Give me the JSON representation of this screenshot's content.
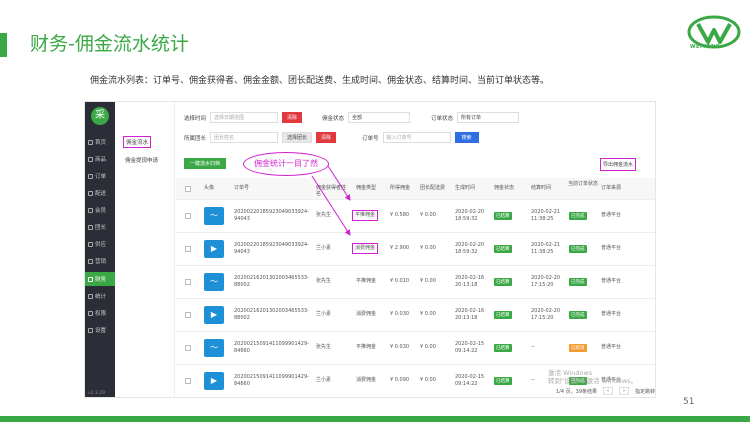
{
  "slide": {
    "title": "财务-佣金流水统计",
    "description": "佣金流水列表：订单号、佣金获得者、佣金金额、团长配送费、生成时间、佣金状态、结算时间、当前订单状态等。",
    "page_number": "51",
    "logo_text": "WEIYONG",
    "callout": "佣金统计一目了然"
  },
  "sidebar": {
    "logo_glyph": "采",
    "items": [
      {
        "label": "首页",
        "icon": "home-icon"
      },
      {
        "label": "商品",
        "icon": "goods-icon"
      },
      {
        "label": "订单",
        "icon": "order-icon"
      },
      {
        "label": "配送",
        "icon": "delivery-icon"
      },
      {
        "label": "会员",
        "icon": "member-icon"
      },
      {
        "label": "团长",
        "icon": "leader-icon"
      },
      {
        "label": "供应",
        "icon": "supply-icon"
      },
      {
        "label": "营销",
        "icon": "marketing-icon"
      },
      {
        "label": "财务",
        "icon": "finance-icon",
        "active": true
      },
      {
        "label": "统计",
        "icon": "stats-icon"
      },
      {
        "label": "权限",
        "icon": "permission-icon"
      },
      {
        "label": "设置",
        "icon": "settings-icon"
      }
    ],
    "version": "v2.3.29"
  },
  "subnav": {
    "items": [
      "佣金流水",
      "佣金提现申请"
    ]
  },
  "filters": {
    "time_label": "选择时间",
    "time_placeholder": "选择日期范围",
    "clear_label": "清除",
    "status_label": "佣金状态",
    "status_value": "全部",
    "order_status_label": "订单状态",
    "order_status_value": "所有订单",
    "leader_label": "所属团长",
    "leader_placeholder": "团长姓名",
    "select_leader_label": "选择团长",
    "clear2_label": "清除",
    "order_no_label": "订单号",
    "order_no_placeholder": "输入订单号",
    "search_label": "搜索"
  },
  "toolbar": {
    "settle_label": "一键流水归档",
    "export_label": "导出佣金流水"
  },
  "table": {
    "headers": [
      "头像",
      "订单号",
      "佣金获得者姓名",
      "佣金类型",
      "所得佣金",
      "团长配送费",
      "生成时间",
      "佣金状态",
      "结算时间",
      "当前订单状态",
      "订单来源"
    ],
    "rows": [
      {
        "order": "2020022018592304903392494043",
        "order_a": "20200220185923049033924-",
        "order_b": "94043",
        "name": "张先生",
        "type": "平推佣金",
        "amount": "¥ 0.580",
        "fee": "¥ 0.00",
        "created_a": "2020-02-20",
        "created_b": "18:59:32",
        "status": "已结算",
        "settled_a": "2020-02-21",
        "settled_b": "11:38:25",
        "order_status": "已完成",
        "source": "普通平台",
        "hl_type": true
      },
      {
        "order_a": "20200220185923049033924-",
        "order_b": "94043",
        "name": "兰小素",
        "type": "消费佣金",
        "amount": "¥ 2.900",
        "fee": "¥ 0.00",
        "created_a": "2020-02-20",
        "created_b": "18:59:32",
        "status": "已结算",
        "settled_a": "2020-02-21",
        "settled_b": "11:38:25",
        "order_status": "已完成",
        "source": "普通平台",
        "hl_type": true
      },
      {
        "order_a": "20200216201302003465533-",
        "order_b": "88002",
        "name": "张先生",
        "type": "平推佣金",
        "amount": "¥ 0.010",
        "fee": "¥ 0.00",
        "created_a": "2020-02-16",
        "created_b": "20:13:18",
        "status": "已结算",
        "settled_a": "2020-02-20",
        "settled_b": "17:15:20",
        "order_status": "已完成",
        "source": "普通平台"
      },
      {
        "order_a": "20200216201302003465533-",
        "order_b": "88002",
        "name": "兰小素",
        "type": "消费佣金",
        "amount": "¥ 0.030",
        "fee": "¥ 0.00",
        "created_a": "2020-02-16",
        "created_b": "20:13:18",
        "status": "已结算",
        "settled_a": "2020-02-20",
        "settled_b": "17:15:20",
        "order_status": "已完成",
        "source": "普通平台"
      },
      {
        "order_a": "20200215091411099901429-",
        "order_b": "84660",
        "name": "张先生",
        "type": "平推佣金",
        "amount": "¥ 0.030",
        "fee": "¥ 0.00",
        "created_a": "2020-02-15",
        "created_b": "09:14:22",
        "status": "已结算",
        "settled_a": "--",
        "settled_b": "",
        "order_status": "已取消",
        "source": "普通平台"
      },
      {
        "order_a": "20200215091411099901429-",
        "order_b": "84660",
        "name": "兰小素",
        "type": "消费佣金",
        "amount": "¥ 0.090",
        "fee": "¥ 0.00",
        "created_a": "2020-02-15",
        "created_b": "09:14:22",
        "status": "已结算",
        "settled_a": "--",
        "settled_b": "",
        "order_status": "已完成",
        "source": "普通平台"
      }
    ]
  },
  "pager": {
    "summary": "1/4 页，39条结果",
    "jump_label": "指定跳转"
  },
  "watermark": {
    "line1": "激活 Windows",
    "line2": "转到\"设置\"以激活 Windows。"
  },
  "colors": {
    "accent": "#3aa845",
    "highlight": "#d020d0",
    "danger": "#e0393e",
    "primary": "#2d6fe0"
  }
}
